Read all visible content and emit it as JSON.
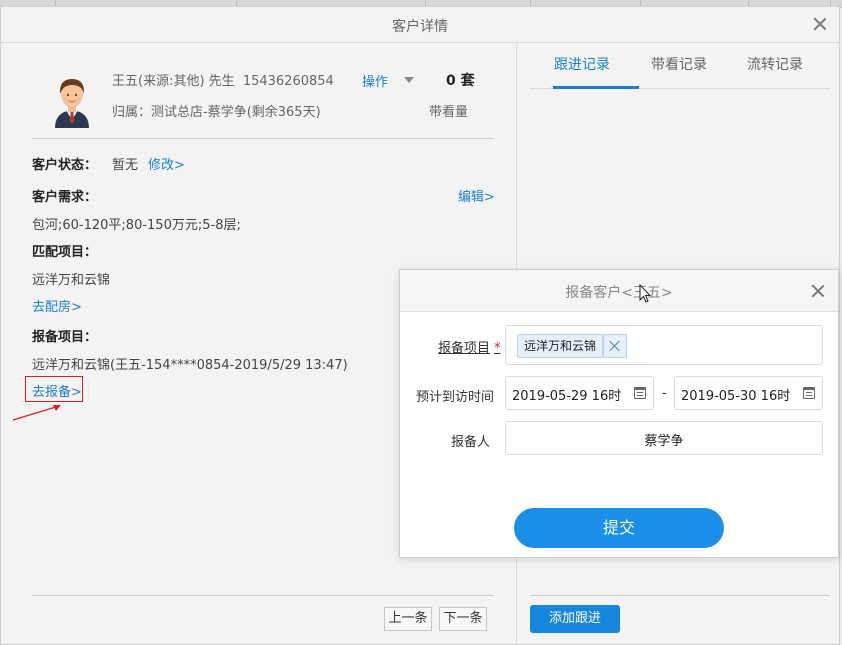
{
  "modal": {
    "title": "客户详情"
  },
  "customer": {
    "name_source": "王五(来源:其他)",
    "title_suffix": "先生",
    "phone": "15436260854",
    "operation_label": "操作",
    "view_count": "0 套",
    "belong": "归属：测试总店-蔡学争(剩余365天)",
    "view_count_label": "带看量"
  },
  "status": {
    "label": "客户状态：",
    "value": "暂无",
    "edit_link": "修改>"
  },
  "needs": {
    "label": "客户需求：",
    "edit_link": "编辑>",
    "value": "包河;60-120平;80-150万元;5-8层;"
  },
  "match": {
    "label": "匹配项目：",
    "value": "远洋万和云锦",
    "link": "去配房>"
  },
  "report": {
    "label": "报备项目：",
    "value": "远洋万和云锦(王五-154****0854-2019/5/29 13:47)",
    "link": "去报备>"
  },
  "pager": {
    "prev": "上一条",
    "next": "下一条"
  },
  "tabs": [
    {
      "label": "跟进记录",
      "active": true
    },
    {
      "label": "带看记录",
      "active": false
    },
    {
      "label": "流转记录",
      "active": false
    }
  ],
  "add_follow_label": "添加跟进",
  "dialog": {
    "title": "报备客户<王五>",
    "project_label": "报备项目",
    "required_mark": "*",
    "project_tag": "远洋万和云锦",
    "visit_time_label": "预计到访时间",
    "date_from": "2019-05-29 16时",
    "date_sep": "-",
    "date_to": "2019-05-30 16时",
    "reporter_label": "报备人",
    "reporter_value": "蔡学争",
    "submit_label": "提交"
  },
  "colors": {
    "accent": "#1a7fd4",
    "button": "#1585de",
    "submit": "#1a8ee8",
    "highlight": "#e02020"
  }
}
